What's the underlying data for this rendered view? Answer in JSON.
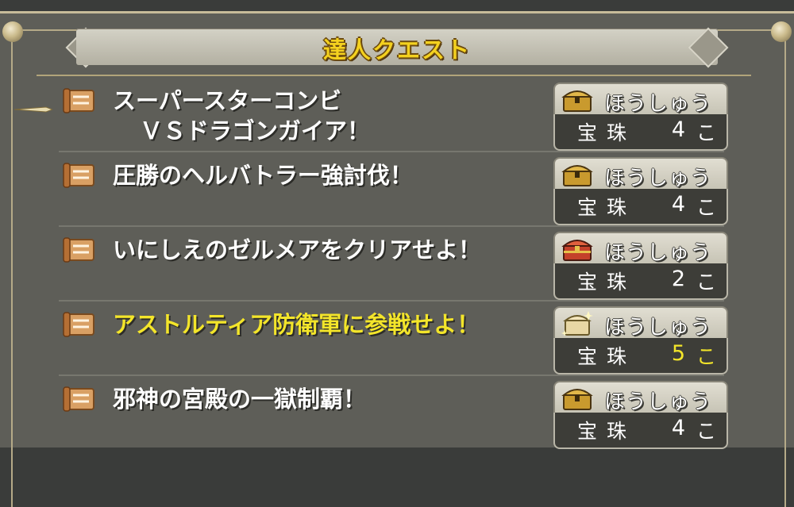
{
  "header": {
    "title": "達人クエスト"
  },
  "reward_label": "ほうしゅう",
  "quests": [
    {
      "title_line1": "スーパースターコンビ",
      "title_line2": "ＶＳドラゴンガイア！",
      "reward_item": "宝珠",
      "reward_qty": "4",
      "reward_unit": "こ",
      "chest": "gold-chest-icon",
      "highlight": false
    },
    {
      "title_line1": "圧勝のヘルバトラー強討伐！",
      "title_line2": "",
      "reward_item": "宝珠",
      "reward_qty": "4",
      "reward_unit": "こ",
      "chest": "gold-chest-icon",
      "highlight": false
    },
    {
      "title_line1": "いにしえのゼルメアをクリアせよ！",
      "title_line2": "",
      "reward_item": "宝珠",
      "reward_qty": "2",
      "reward_unit": "こ",
      "chest": "red-chest-icon",
      "highlight": false
    },
    {
      "title_line1": "アストルティア防衛軍に参戦せよ！",
      "title_line2": "",
      "reward_item": "宝珠",
      "reward_qty": "5",
      "reward_unit": "こ",
      "chest": "sparkle-chest-icon",
      "highlight": true
    },
    {
      "title_line1": "邪神の宮殿の一獄制覇！",
      "title_line2": "",
      "reward_item": "宝珠",
      "reward_qty": "4",
      "reward_unit": "こ",
      "chest": "gold-chest-icon",
      "highlight": false
    }
  ],
  "colors": {
    "title_yellow": "#f4d11f",
    "highlight_yellow": "#f3e52a",
    "panel_bg": "#5e5e58"
  }
}
